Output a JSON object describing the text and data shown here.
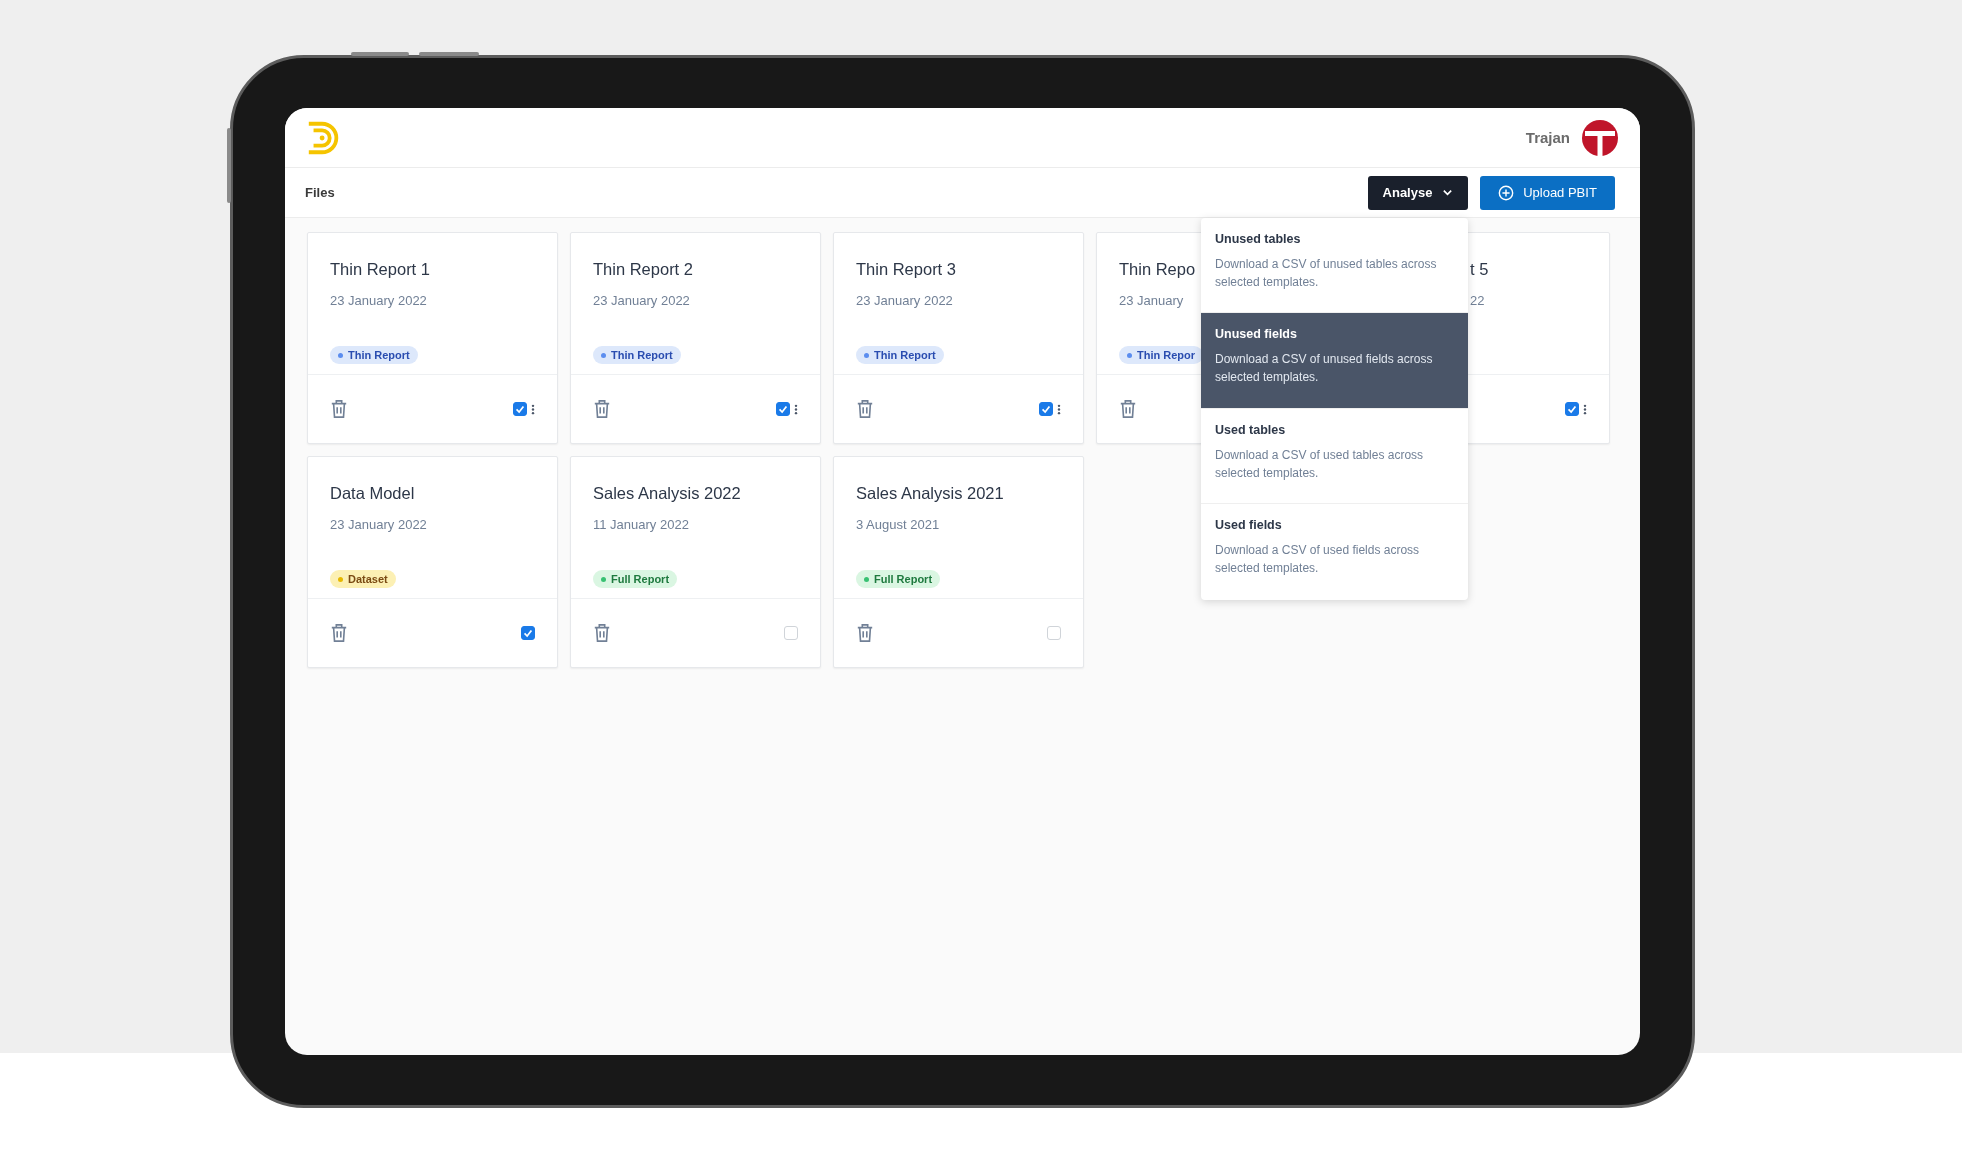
{
  "header": {
    "user_name": "Trajan"
  },
  "toolbar": {
    "title": "Files",
    "analyse_button": {
      "label": "Analyse",
      "expanded": true
    },
    "upload_button": {
      "label": "Upload PBIT"
    }
  },
  "cards": [
    {
      "kind": "full",
      "title": "Thin Report 1",
      "date": "23 January 2022",
      "tag": {
        "label": "Thin Report",
        "kind": "thin"
      },
      "checked": true,
      "menu_icon": true
    },
    {
      "kind": "full",
      "title": "Thin Report 2",
      "date": "23 January 2022",
      "tag": {
        "label": "Thin Report",
        "kind": "thin"
      },
      "checked": true,
      "menu_icon": true
    },
    {
      "kind": "full",
      "title": "Thin Report 3",
      "date": "23 January 2022",
      "tag": {
        "label": "Thin Report",
        "kind": "thin"
      },
      "checked": true,
      "menu_icon": true
    },
    {
      "kind": "covered-right",
      "title": "Thin Repo",
      "date": "23 January",
      "tag": {
        "label": "Thin Repor",
        "kind": "thin"
      }
    },
    {
      "kind": "covered-left",
      "title": "t 5",
      "date": "22",
      "checked": true,
      "menu_icon": true
    },
    {
      "kind": "full",
      "title": "Data Model",
      "date": "23 January 2022",
      "tag": {
        "label": "Dataset",
        "kind": "dataset"
      },
      "checked": true,
      "menu_icon": false
    },
    {
      "kind": "full",
      "title": "Sales Analysis 2022",
      "date": "11 January 2022",
      "tag": {
        "label": "Full Report",
        "kind": "full"
      },
      "checked": false,
      "menu_icon": false
    },
    {
      "kind": "full",
      "title": "Sales Analysis 2021",
      "date": "3 August 2021",
      "tag": {
        "label": "Full Report",
        "kind": "full"
      },
      "checked": false,
      "menu_icon": false
    }
  ],
  "analyse_menu": [
    {
      "title": "Unused tables",
      "description": "Download a CSV of unused tables across selected templates.",
      "selected": false
    },
    {
      "title": "Unused fields",
      "description": "Download a CSV of unused fields across selected templates.",
      "selected": true
    },
    {
      "title": "Used tables",
      "description": "Download a CSV of used tables across selected templates.",
      "selected": false
    },
    {
      "title": "Used fields",
      "description": "Download a CSV of used fields across selected templates.",
      "selected": false
    }
  ]
}
